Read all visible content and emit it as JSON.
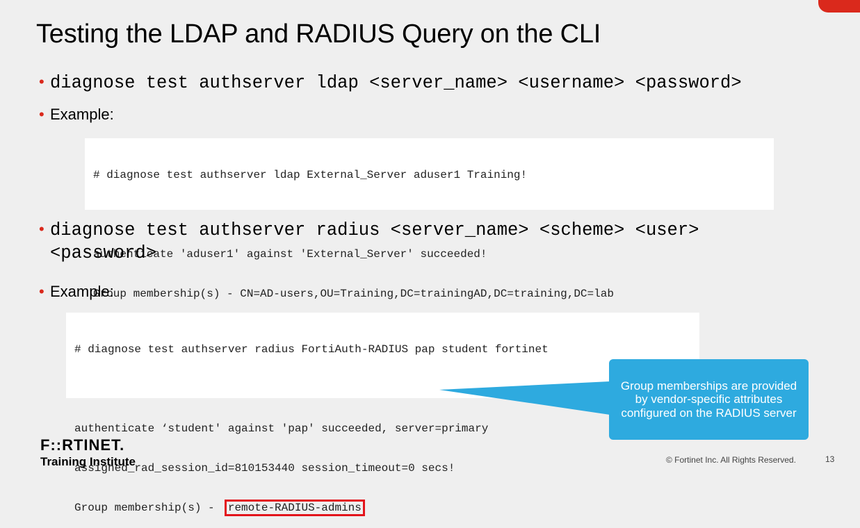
{
  "slide": {
    "title": "Testing the LDAP and RADIUS Query on the CLI",
    "bullets": {
      "ldap_cmd": "diagnose test authserver ldap <server_name> <username> <password>",
      "example1": "Example:",
      "radius_cmd_line1": "diagnose test authserver radius <server_name> <scheme> <user>",
      "radius_cmd_line2": "<password>",
      "example2": "Example:"
    },
    "ldap_example": {
      "line1": "# diagnose test authserver ldap External_Server aduser1 Training!",
      "line2": "",
      "line3": "authenticate 'aduser1' against 'External_Server' succeeded!",
      "line4": "Group membership(s) - CN=AD-users,OU=Training,DC=trainingAD,DC=training,DC=lab"
    },
    "radius_example": {
      "line1": "# diagnose test authserver radius FortiAuth-RADIUS pap student fortinet",
      "line2": "",
      "line3": "authenticate ‘student' against 'pap' succeeded, server=primary",
      "line4": "assigned_rad_session_id=810153440 session_timeout=0 secs!",
      "line5_prefix": "Group membership(s) - ",
      "line5_highlight": "remote-RADIUS-admins"
    },
    "callout": "Group memberships are provided by vendor-specific attributes configured on the RADIUS server"
  },
  "footer": {
    "logo_word": "F::RTINET.",
    "logo_sub": "Training Institute",
    "copyright": "© Fortinet Inc. All Rights Reserved.",
    "page_number": "13"
  },
  "colors": {
    "accent_red": "#da291c",
    "callout_blue": "#2eaadf",
    "highlight_border": "#e3141b"
  }
}
